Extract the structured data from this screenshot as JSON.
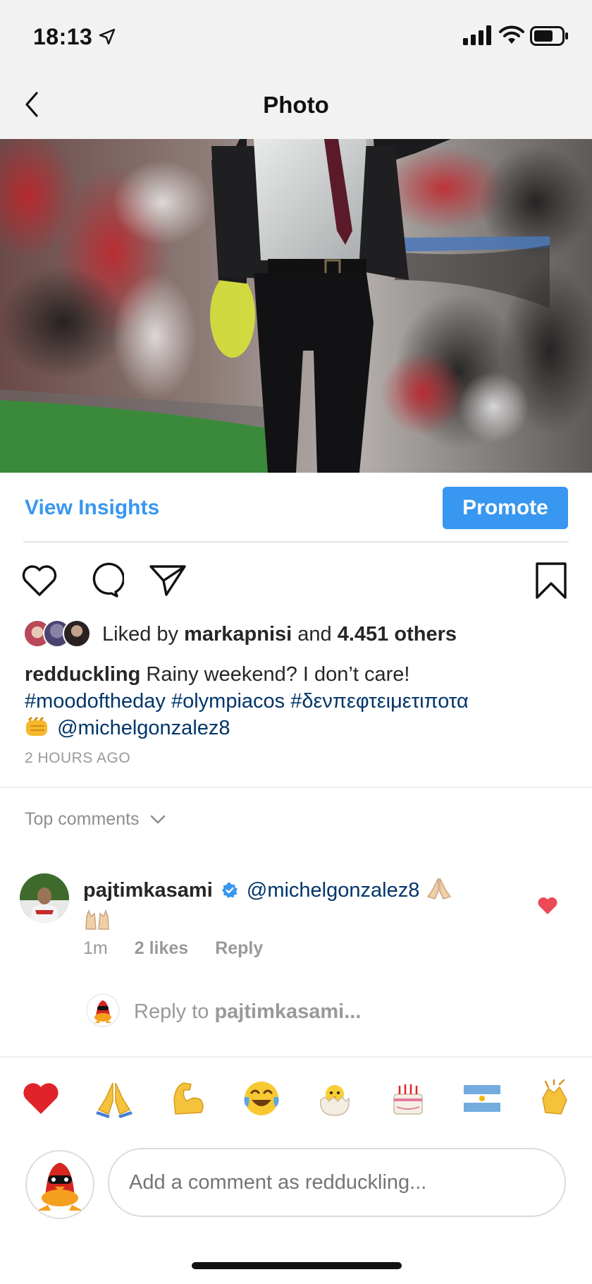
{
  "status_bar": {
    "time": "18:13"
  },
  "nav": {
    "title": "Photo"
  },
  "insights": {
    "view_label": "View Insights",
    "promote_label": "Promote"
  },
  "likes": {
    "prefix": "Liked by",
    "user": "markapnisi",
    "middle": "and",
    "count": "4.451 others"
  },
  "post": {
    "username": "redduckling",
    "caption": "Rainy weekend? I don’t care!",
    "hashtags": "#moodoftheday #olympiacos #δενπεφτειμετιποτα",
    "mention": "@michelgonzalez8",
    "time_ago": "2 HOURS AGO"
  },
  "comments": {
    "header": "Top comments",
    "items": [
      {
        "username": "pajtimkasami",
        "text": "@michelgonzalez8",
        "time": "1m",
        "likes": "2 likes",
        "reply": "Reply"
      }
    ],
    "reply_prefix": "Reply to",
    "reply_user": "pajtimkasami..."
  },
  "emoji_bar": [
    "heart",
    "pray",
    "muscle",
    "joy",
    "hatching-chick",
    "cake",
    "argentina-flag",
    "clap"
  ],
  "composer": {
    "placeholder": "Add a comment as redduckling..."
  },
  "colors": {
    "accent": "#3897f0",
    "hashtag": "#003569",
    "like_red": "#ed4956"
  }
}
